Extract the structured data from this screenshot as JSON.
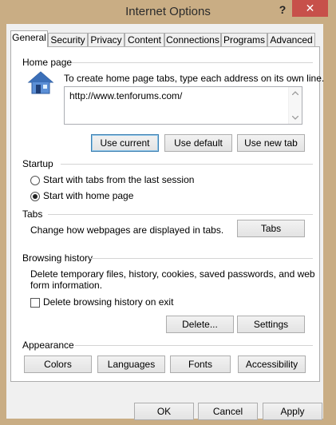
{
  "window": {
    "title": "Internet Options",
    "help_label": "?",
    "close_label": "✕"
  },
  "tabs": [
    {
      "label": "General"
    },
    {
      "label": "Security"
    },
    {
      "label": "Privacy"
    },
    {
      "label": "Content"
    },
    {
      "label": "Connections"
    },
    {
      "label": "Programs"
    },
    {
      "label": "Advanced"
    }
  ],
  "home_page": {
    "group_label": "Home page",
    "description": "To create home page tabs, type each address on its own line.",
    "url": "http://www.tenforums.com/",
    "use_current": "Use current",
    "use_default": "Use default",
    "use_new_tab": "Use new tab"
  },
  "startup": {
    "group_label": "Startup",
    "option1": "Start with tabs from the last session",
    "option2": "Start with home page",
    "selected": "option2"
  },
  "tabs_section": {
    "group_label": "Tabs",
    "description": "Change how webpages are displayed in tabs.",
    "button": "Tabs"
  },
  "browsing_history": {
    "group_label": "Browsing history",
    "description_line1": "Delete temporary files, history, cookies, saved passwords, and web",
    "description_line2": "form information.",
    "delete_on_exit": "Delete browsing history on exit",
    "delete_on_exit_checked": false,
    "delete_button": "Delete...",
    "settings_button": "Settings"
  },
  "appearance": {
    "group_label": "Appearance",
    "colors": "Colors",
    "languages": "Languages",
    "fonts": "Fonts",
    "accessibility": "Accessibility"
  },
  "dialog_buttons": {
    "ok": "OK",
    "cancel": "Cancel",
    "apply": "Apply"
  }
}
